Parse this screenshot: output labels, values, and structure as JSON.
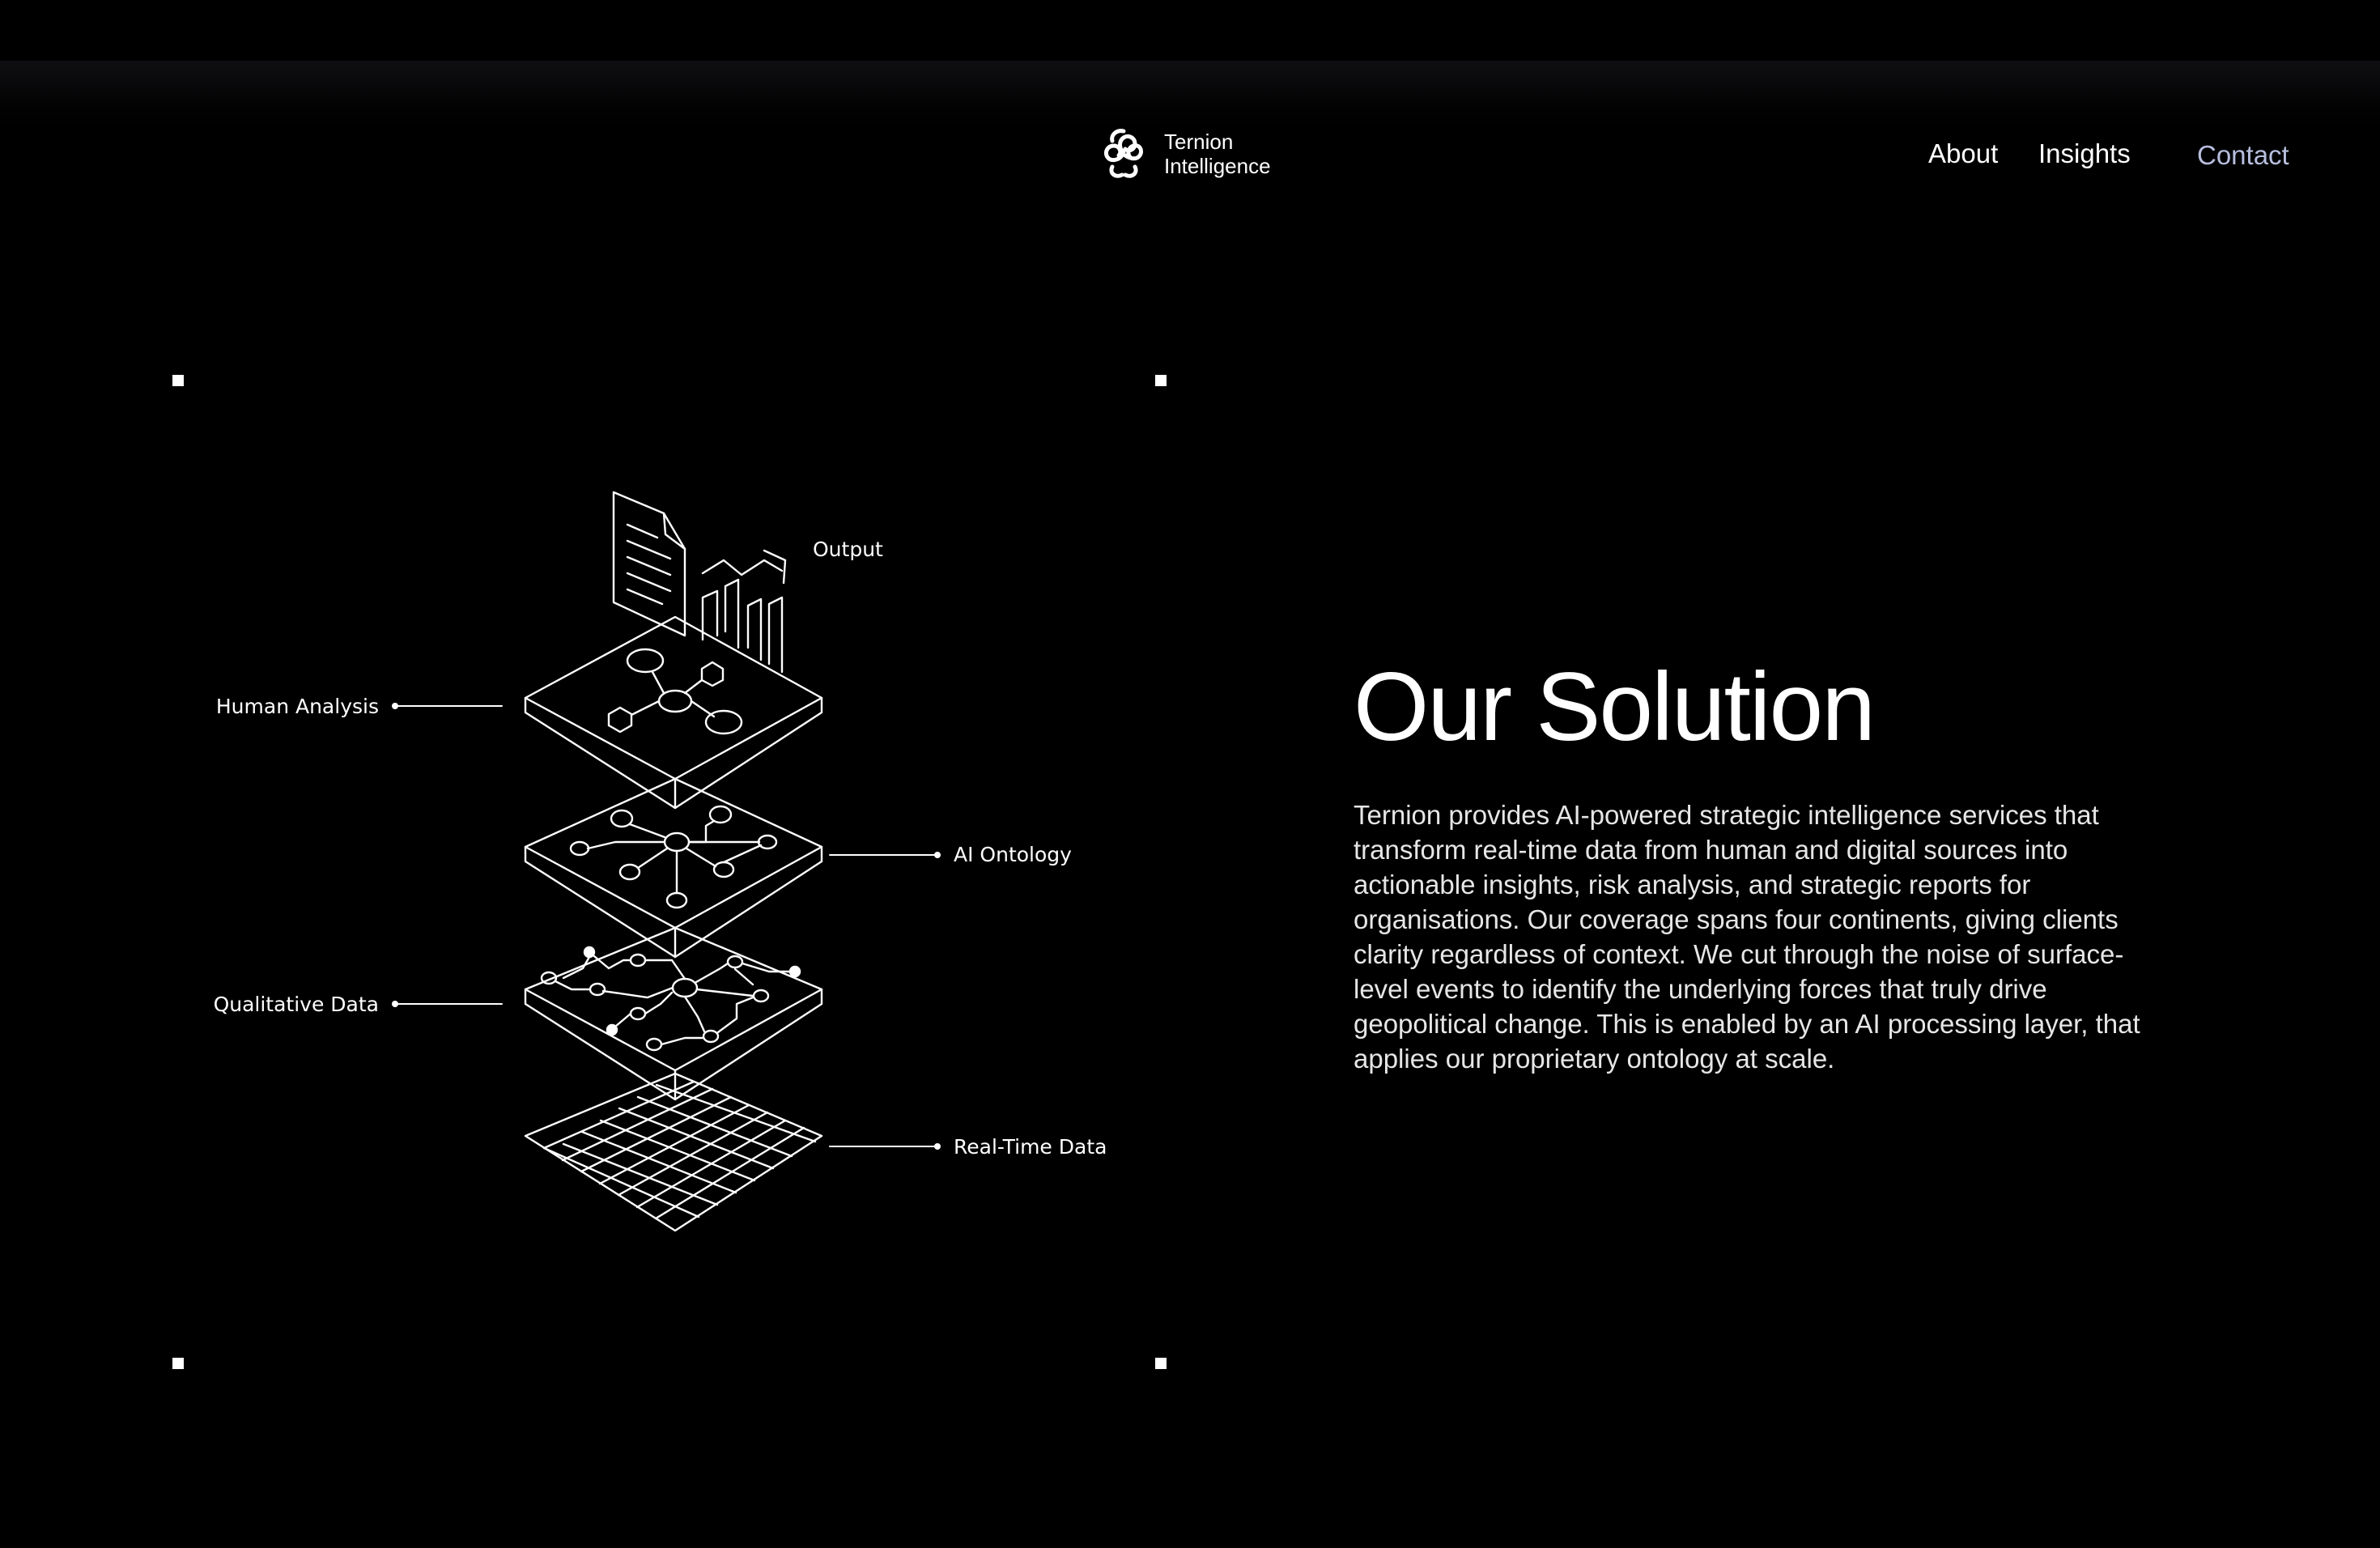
{
  "brand": {
    "name_line1": "Ternion",
    "name_line2": "Intelligence",
    "logo_icon": "triskelion-spiral-icon"
  },
  "nav": {
    "about": "About",
    "insights": "Insights",
    "contact": "Contact"
  },
  "colors": {
    "background": "#000000",
    "text": "#ffffff",
    "contact_link": "#b7bedd"
  },
  "diagram": {
    "labels": {
      "output": "Output",
      "human_analysis": "Human Analysis",
      "ai_ontology": "AI Ontology",
      "qualitative_data": "Qualitative Data",
      "real_time_data": "Real-Time Data"
    }
  },
  "solution": {
    "title": "Our Solution",
    "body": "Ternion provides AI-powered strategic intelligence services that transform real-time data from human and digital sources into actionable insights, risk analysis, and strategic reports for organisations. Our coverage spans four continents, giving clients clarity regardless of context. We cut through the noise of surface-level events to identify the underlying forces that truly drive geopolitical change. This is enabled by an AI processing layer, that applies our proprietary ontology at scale."
  }
}
